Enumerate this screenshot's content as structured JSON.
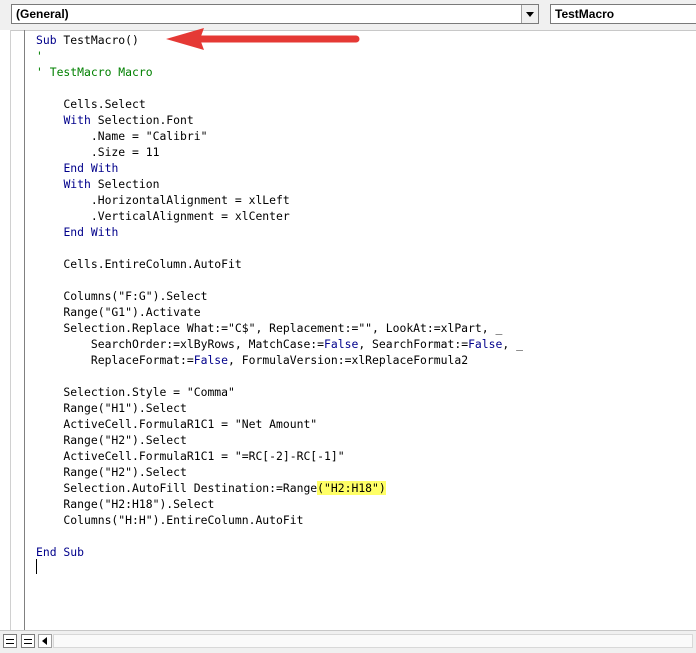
{
  "toolbar": {
    "object_combo": "(General)",
    "procedure_combo": "TestMacro"
  },
  "code": {
    "lines": [
      [
        {
          "t": "Sub",
          "c": "kw"
        },
        {
          "t": " TestMacro()"
        }
      ],
      [
        {
          "t": "'",
          "c": "cm"
        }
      ],
      [
        {
          "t": "' TestMacro Macro",
          "c": "cm"
        }
      ],
      [],
      [
        {
          "t": "    Cells.Select"
        }
      ],
      [
        {
          "t": "    "
        },
        {
          "t": "With",
          "c": "kw"
        },
        {
          "t": " Selection.Font"
        }
      ],
      [
        {
          "t": "        .Name = \"Calibri\""
        }
      ],
      [
        {
          "t": "        .Size = 11"
        }
      ],
      [
        {
          "t": "    "
        },
        {
          "t": "End With",
          "c": "kw"
        }
      ],
      [
        {
          "t": "    "
        },
        {
          "t": "With",
          "c": "kw"
        },
        {
          "t": " Selection"
        }
      ],
      [
        {
          "t": "        .HorizontalAlignment = xlLeft"
        }
      ],
      [
        {
          "t": "        .VerticalAlignment = xlCenter"
        }
      ],
      [
        {
          "t": "    "
        },
        {
          "t": "End With",
          "c": "kw"
        }
      ],
      [],
      [
        {
          "t": "    Cells.EntireColumn.AutoFit"
        }
      ],
      [],
      [
        {
          "t": "    Columns(\"F:G\").Select"
        }
      ],
      [
        {
          "t": "    Range(\"G1\").Activate"
        }
      ],
      [
        {
          "t": "    Selection.Replace What:=\"C$\", Replacement:=\"\", LookAt:=xlPart, _"
        }
      ],
      [
        {
          "t": "        SearchOrder:=xlByRows, MatchCase:="
        },
        {
          "t": "False",
          "c": "kw"
        },
        {
          "t": ", SearchFormat:="
        },
        {
          "t": "False",
          "c": "kw"
        },
        {
          "t": ", _"
        }
      ],
      [
        {
          "t": "        ReplaceFormat:="
        },
        {
          "t": "False",
          "c": "kw"
        },
        {
          "t": ", FormulaVersion:=xlReplaceFormula2"
        }
      ],
      [],
      [
        {
          "t": "    Selection.Style = \"Comma\""
        }
      ],
      [
        {
          "t": "    Range(\"H1\").Select"
        }
      ],
      [
        {
          "t": "    ActiveCell.FormulaR1C1 = \"Net Amount\""
        }
      ],
      [
        {
          "t": "    Range(\"H2\").Select"
        }
      ],
      [
        {
          "t": "    ActiveCell.FormulaR1C1 = \"=RC[-2]-RC[-1]\""
        }
      ],
      [
        {
          "t": "    Range(\"H2\").Select"
        }
      ],
      [
        {
          "t": "    Selection.AutoFill Destination:=Range"
        },
        {
          "t": "(\"H2:H18\")",
          "c": "hl"
        }
      ],
      [
        {
          "t": "    Range(\"H2:H18\").Select"
        }
      ],
      [
        {
          "t": "    Columns(\"H:H\").EntireColumn.AutoFit"
        }
      ],
      [],
      [
        {
          "t": "End Sub",
          "c": "kw"
        }
      ]
    ]
  },
  "colors": {
    "keyword": "#00008b",
    "comment": "#008000",
    "highlight": "#ffff66",
    "arrow": "#e53935"
  }
}
